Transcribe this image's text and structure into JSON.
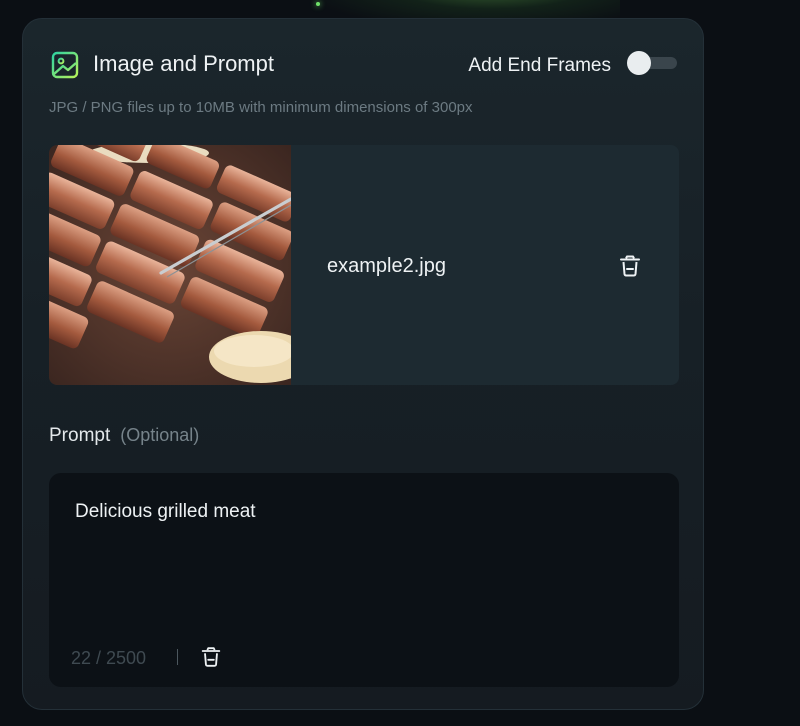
{
  "header": {
    "title": "Image and Prompt",
    "icon": "image-icon",
    "end_frames_label": "Add End Frames",
    "end_frames_enabled": false
  },
  "upload": {
    "hint": "JPG / PNG files up to 10MB with minimum dimensions of 300px",
    "file_name": "example2.jpg",
    "thumbnail": "grilled-meat-photo",
    "delete_icon": "trash-icon"
  },
  "prompt": {
    "label": "Prompt",
    "optional_label": "(Optional)",
    "value": "Delicious grilled meat",
    "char_count": "22 / 2500",
    "delete_icon": "trash-icon"
  },
  "colors": {
    "card_background": "#1b262c",
    "file_row_background": "#1d2a31",
    "prompt_background": "#0c1116",
    "accent_gradient_start": "#2fd3a0",
    "accent_gradient_end": "#b6f25a"
  }
}
